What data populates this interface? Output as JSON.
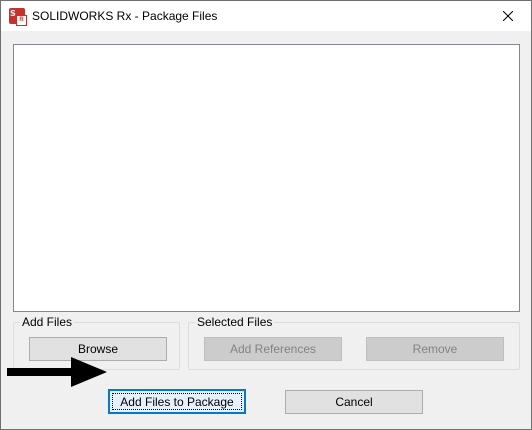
{
  "window": {
    "title": "SOLIDWORKS Rx - Package Files",
    "app_icon": "solidworks-rx-icon",
    "close_icon": "close-icon"
  },
  "file_list": {
    "items": []
  },
  "add_files_group": {
    "label": "Add Files",
    "browse_label": "Browse"
  },
  "selected_files_group": {
    "label": "Selected Files",
    "add_references_label": "Add References",
    "remove_label": "Remove"
  },
  "footer": {
    "add_to_package_label": "Add Files to Package",
    "cancel_label": "Cancel",
    "pointer_arrow": "right-arrow-icon"
  },
  "colors": {
    "dialog_bg": "#f0f0f0",
    "button_bg": "#e1e1e1",
    "disabled_button_bg": "#cccccc",
    "disabled_text": "#838383",
    "focus_border": "#0078d7",
    "icon_red": "#c8302b"
  }
}
